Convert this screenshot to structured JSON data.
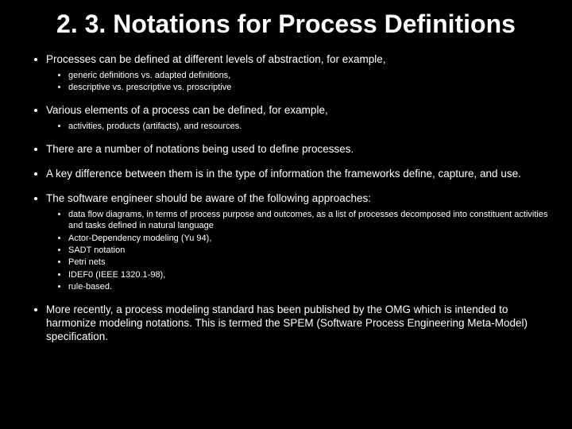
{
  "title": "2. 3. Notations for Process Definitions",
  "points": {
    "p1": "Processes can be defined at different levels of abstraction, for example,",
    "p1s": {
      "a": "generic definitions vs. adapted definitions,",
      "b": "descriptive vs. prescriptive vs. proscriptive"
    },
    "p2": "Various elements of a process can be defined, for example,",
    "p2s": {
      "a": "activities, products (artifacts), and resources."
    },
    "p3": "There are a number of notations being used to define processes.",
    "p4": " A key difference between them is in the type of information the frameworks define, capture, and use.",
    "p5": "The software engineer should be aware of the following approaches:",
    "p5s": {
      "a": "data flow diagrams, in terms of process purpose and outcomes, as a list of processes decomposed into constituent activities and tasks defined in natural language",
      "b": "Actor-Dependency modeling (Yu 94),",
      "c": "SADT notation",
      "d": "Petri nets",
      "e": "IDEF0 (IEEE 1320.1-98),",
      "f": "rule-based."
    },
    "p6": "More recently, a process modeling standard has been published by the OMG which is intended to harmonize modeling notations. This is termed the SPEM (Software Process Engineering Meta-Model) specification."
  }
}
